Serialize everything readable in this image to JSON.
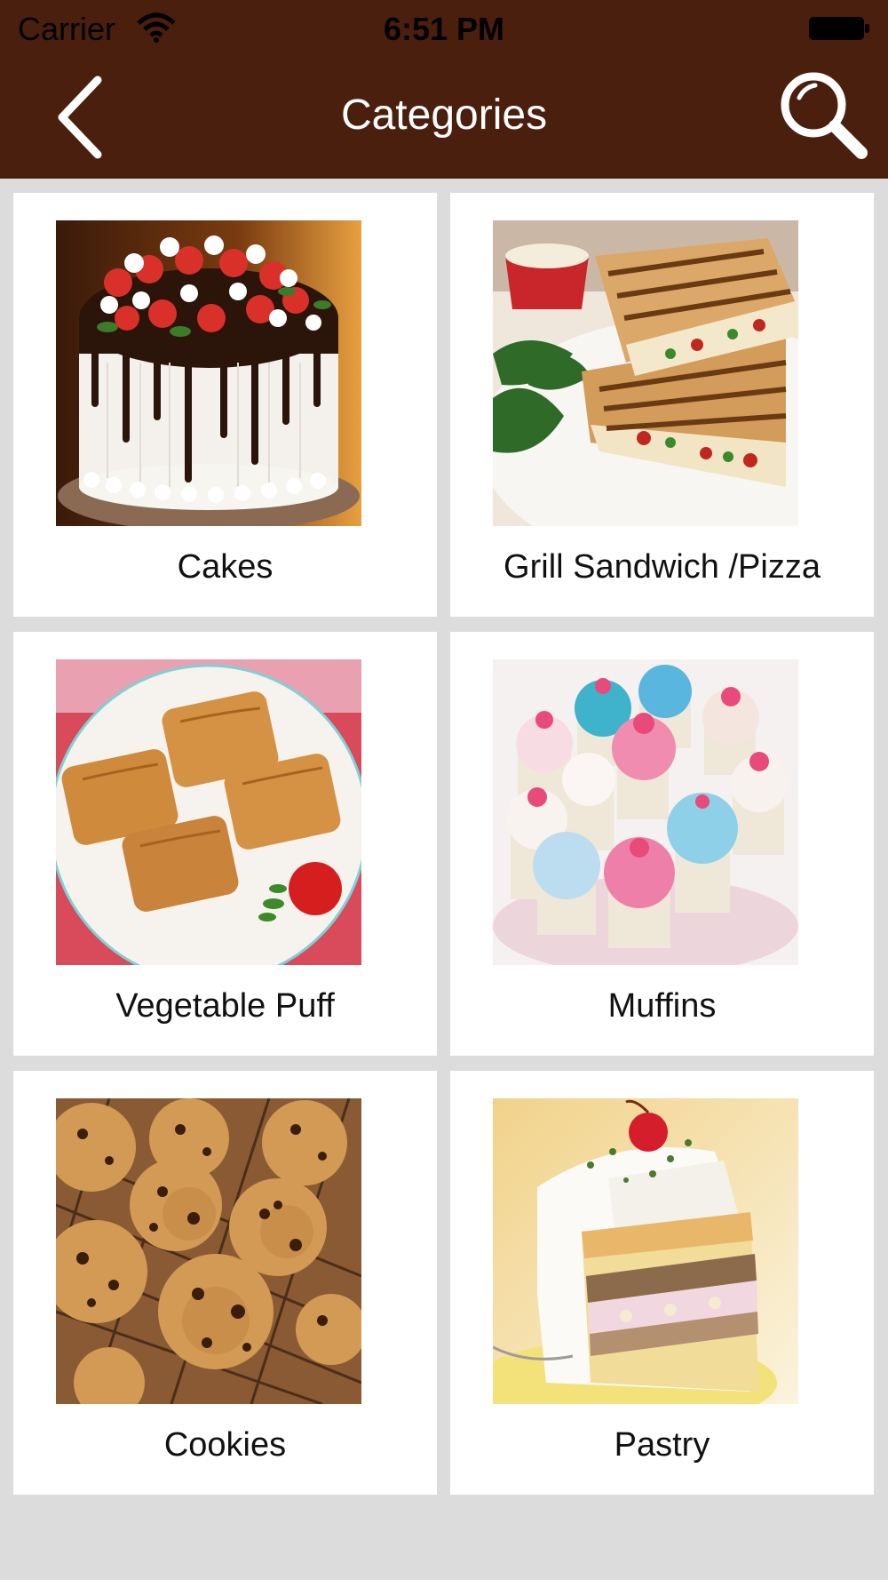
{
  "status_bar": {
    "carrier": "Carrier",
    "time": "6:51 PM"
  },
  "nav": {
    "title": "Categories"
  },
  "categories": [
    {
      "label": "Cakes",
      "image": "chocolate-strawberry-cake"
    },
    {
      "label": "Grill Sandwich /Pizza",
      "image": "grilled-sandwich"
    },
    {
      "label": "Vegetable Puff",
      "image": "vegetable-puff"
    },
    {
      "label": "Muffins",
      "image": "decorated-muffins"
    },
    {
      "label": "Cookies",
      "image": "chocolate-chip-cookies"
    },
    {
      "label": "Pastry",
      "image": "layered-pastry"
    }
  ],
  "colors": {
    "header": "#4b1f0e",
    "background": "#dcdcdc",
    "card": "#ffffff"
  }
}
